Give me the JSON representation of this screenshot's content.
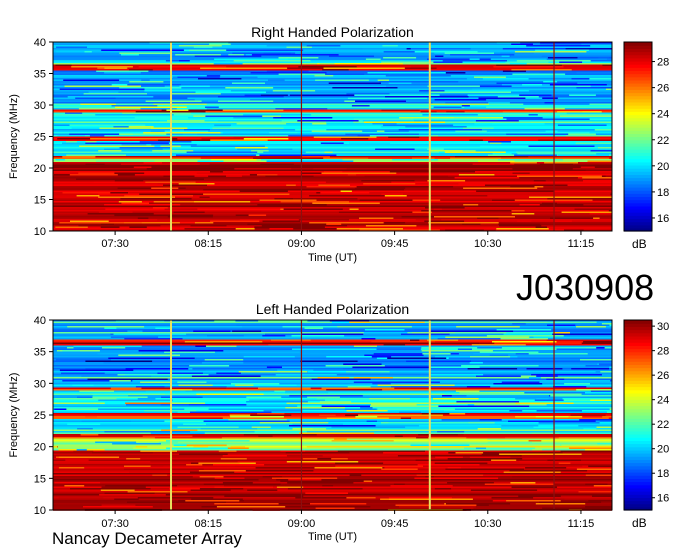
{
  "figure": {
    "code": "J030908",
    "footer": "Nancay Decameter Array"
  },
  "chart_data": [
    {
      "type": "heatmap",
      "title": "Right Handed Polarization",
      "xlabel": "Time (UT)",
      "ylabel": "Frequency (MHz)",
      "x_ticks": [
        "07:30",
        "08:15",
        "09:00",
        "09:45",
        "10:30",
        "11:15"
      ],
      "y_ticks": [
        10,
        15,
        20,
        25,
        30,
        35,
        40
      ],
      "ylim": [
        10,
        40
      ],
      "colorbar": {
        "unit": "dB",
        "ticks": [
          16,
          18,
          20,
          22,
          24,
          26,
          28
        ],
        "range": [
          15,
          29.5
        ]
      },
      "colormap": "jet",
      "bright_bands_MHz": [
        [
          10,
          21
        ],
        [
          21.5,
          22
        ],
        [
          24.5,
          25
        ],
        [
          29,
          29.5
        ],
        [
          35.5,
          36.5
        ]
      ],
      "vertical_lines_time": [
        "07:57",
        "09:00",
        "10:02",
        "11:02"
      ]
    },
    {
      "type": "heatmap",
      "title": "Left Handed Polarization",
      "xlabel": "Time (UT)",
      "ylabel": "Frequency (MHz)",
      "x_ticks": [
        "07:30",
        "08:15",
        "09:00",
        "09:45",
        "10:30",
        "11:15"
      ],
      "y_ticks": [
        10,
        15,
        20,
        25,
        30,
        35,
        40
      ],
      "ylim": [
        10,
        40
      ],
      "colorbar": {
        "unit": "dB",
        "ticks": [
          16,
          18,
          20,
          22,
          24,
          26,
          28,
          30
        ],
        "range": [
          15,
          30.5
        ]
      },
      "colormap": "jet",
      "bright_bands_MHz": [
        [
          10,
          19.5
        ],
        [
          21.5,
          22
        ],
        [
          24.5,
          25.5
        ],
        [
          29,
          29.5
        ],
        [
          36,
          37
        ]
      ],
      "vertical_lines_time": [
        "07:57",
        "09:00",
        "10:02",
        "11:02"
      ]
    }
  ]
}
